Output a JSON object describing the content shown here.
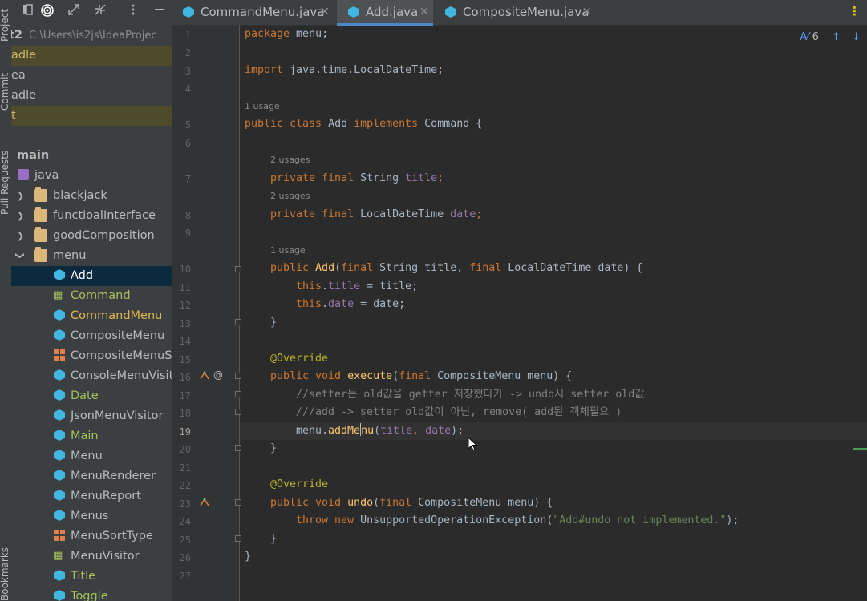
{
  "toolstrip": {
    "project_label": "Project",
    "commit_label": "Commit",
    "pull_requests_label": "Pull Requests",
    "bookmarks_label": "Bookmarks"
  },
  "project_panel": {
    "root_name": "t2",
    "root_path": "C:\\Users\\is2js\\IdeaProjec",
    "tree": [
      {
        "label": "adle",
        "kind": "text",
        "highlight": true
      },
      {
        "label": "ea",
        "kind": "text"
      },
      {
        "label": "adle",
        "kind": "text"
      },
      {
        "label": "t",
        "kind": "text",
        "highlight": true
      },
      {
        "label": "main",
        "kind": "folder-bold"
      },
      {
        "label": "java",
        "kind": "source"
      },
      {
        "label": "blackjack",
        "kind": "folder",
        "expanded": false
      },
      {
        "label": "functioalInterface",
        "kind": "folder",
        "expanded": false
      },
      {
        "label": "goodComposition",
        "kind": "folder",
        "expanded": false
      },
      {
        "label": "menu",
        "kind": "folder",
        "expanded": true
      },
      {
        "label": "Add",
        "kind": "class",
        "selected": true
      },
      {
        "label": "Command",
        "kind": "interface"
      },
      {
        "label": "CommandMenu",
        "kind": "class"
      },
      {
        "label": "CompositeMenu",
        "kind": "class"
      },
      {
        "label": "CompositeMenuSo",
        "kind": "enum"
      },
      {
        "label": "ConsoleMenuVisito",
        "kind": "class"
      },
      {
        "label": "Date",
        "kind": "class"
      },
      {
        "label": "JsonMenuVisitor",
        "kind": "class"
      },
      {
        "label": "Main",
        "kind": "class-main"
      },
      {
        "label": "Menu",
        "kind": "class"
      },
      {
        "label": "MenuRenderer",
        "kind": "class"
      },
      {
        "label": "MenuReport",
        "kind": "class"
      },
      {
        "label": "Menus",
        "kind": "class"
      },
      {
        "label": "MenuSortType",
        "kind": "enum"
      },
      {
        "label": "MenuVisitor",
        "kind": "interface"
      },
      {
        "label": "Title",
        "kind": "class"
      },
      {
        "label": "Toggle",
        "kind": "class"
      }
    ]
  },
  "tabs": [
    {
      "label": "CommandMenu.java",
      "active": false
    },
    {
      "label": "Add.java",
      "active": true
    },
    {
      "label": "CompositeMenu.java",
      "active": false
    }
  ],
  "editor": {
    "inspection_count": "6",
    "current_line": 19,
    "line_numbers": [
      "1",
      "2",
      "3",
      "4",
      "5",
      "6",
      "7",
      "8",
      "9",
      "10",
      "11",
      "12",
      "13",
      "14",
      "15",
      "16",
      "17",
      "18",
      "19",
      "20",
      "21",
      "22",
      "23",
      "24",
      "25",
      "26",
      "27"
    ],
    "usage_hints": {
      "class_usage": "1 usage",
      "title_usages": "2 usages",
      "date_usages": "2 usages",
      "ctor_usage": "1 usage"
    },
    "code": {
      "l1_kw": "package",
      "l1_rest": " menu;",
      "l3_kw": "import",
      "l3_rest": " java.time.LocalDateTime;",
      "l5_kw1": "public class",
      "l5_name": " Add ",
      "l5_kw2": "implements",
      "l5_rest": " Command {",
      "l7_kw": "private final",
      "l7_type": " String ",
      "l7_field": "title",
      "l7_end": ";",
      "l8_kw": "private final",
      "l8_type": " LocalDateTime ",
      "l8_field": "date",
      "l8_end": ";",
      "l10_kw": "public",
      "l10_name": " Add",
      "l10_p1": "(",
      "l10_kw2": "final",
      "l10_p2": " String title, ",
      "l10_kw3": "final",
      "l10_p3": " LocalDateTime date) {",
      "l11_kw": "this",
      "l11_dot": ".",
      "l11_field": "title",
      "l11_rest": " = title;",
      "l12_kw": "this",
      "l12_dot": ".",
      "l12_field": "date",
      "l12_rest": " = date;",
      "l13": "}",
      "l15_ann": "@Override",
      "l16_kw": "public void",
      "l16_name": " execute",
      "l16_p1": "(",
      "l16_kw2": "final",
      "l16_rest": " CompositeMenu menu) {",
      "l17_cmt": "//setter는 old값을 getter 저장했다가 -> undo시 setter old값",
      "l18_cmt": "///add -> setter old값이 아닌, remove( add된 객체필요 )",
      "l19_a": "menu.",
      "l19_fn1": "addMe",
      "l19_fn2": "nu",
      "l19_p": "(",
      "l19_f1": "title",
      "l19_c": ", ",
      "l19_f2": "date",
      "l19_end": ");",
      "l20": "}",
      "l22_ann": "@Override",
      "l23_kw": "public void",
      "l23_name": " undo",
      "l23_p1": "(",
      "l23_kw2": "final",
      "l23_rest": " CompositeMenu menu) {",
      "l24_kw": "throw new",
      "l24_type": " UnsupportedOperationException(",
      "l24_str": "\"Add#undo not implemented.\"",
      "l24_end": ");",
      "l25": "}",
      "l26": "}"
    }
  },
  "colors": {
    "background": "#2b2b2b",
    "panel": "#3c3f41",
    "selection": "#0d293e",
    "accent_tab": "#4a88c7",
    "keyword": "#cc7832",
    "field": "#9876aa",
    "method": "#ffc66d",
    "annotation": "#bbb529",
    "string": "#6a8759",
    "comment": "#808080"
  },
  "icons": {
    "project_toolbar": [
      "library-icon",
      "target-icon",
      "expand-icon",
      "collapse-icon",
      "more-vertical-icon",
      "minimize-icon"
    ],
    "gutter": [
      "implementation-icon",
      "override-icon"
    ],
    "inspection": "inspection-icon"
  }
}
